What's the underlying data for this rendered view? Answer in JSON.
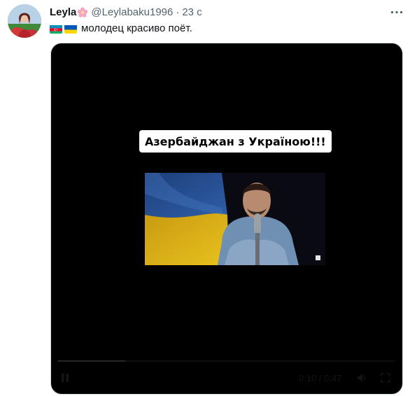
{
  "tweet": {
    "display_name": "Leyla",
    "handle": "@Leylabaku1996",
    "separator": "·",
    "time": "23 с",
    "text": "молодец красиво поёт.",
    "name_emoji_icon": "cherry-blossom-icon",
    "flags": [
      "azerbaijan-flag-icon",
      "ukraine-flag-icon"
    ]
  },
  "media": {
    "caption": "Азербайджан з Україною!!!",
    "time_readout": "0:10 / 0:47",
    "progress": 0.2
  },
  "colors": {
    "text": "#0f1419",
    "muted": "#536471",
    "border": "#cfd9de",
    "ukraine_blue": "#0057b7",
    "ukraine_yellow": "#ffd700"
  }
}
